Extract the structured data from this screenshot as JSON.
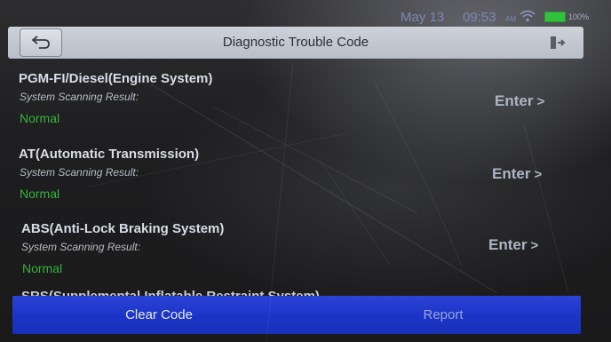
{
  "status_bar": {
    "date": "May 13",
    "time": "09:53",
    "ampm": "AM",
    "battery_label": "100%",
    "wifi_icon": "wifi-icon",
    "battery_color": "#33c13d"
  },
  "header": {
    "title": "Diagnostic Trouble Code",
    "back_icon": "back-arrow-icon",
    "exit_icon": "exit-icon"
  },
  "systems": [
    {
      "name": "PGM-FI/Diesel(Engine System)",
      "label": "System Scanning Result:",
      "status": "Normal",
      "enter_label": "Enter",
      "enter_glyph": ">"
    },
    {
      "name": "AT(Automatic Transmission)",
      "label": "System Scanning Result:",
      "status": "Normal",
      "enter_label": "Enter",
      "enter_glyph": ">"
    },
    {
      "name": "ABS(Anti-Lock Braking System)",
      "label": "System Scanning Result:",
      "status": "Normal",
      "enter_label": "Enter",
      "enter_glyph": ">"
    }
  ],
  "partial_row": "SRS(Supplemental Inflatable Restraint System)",
  "bottom_bar": {
    "clear_code_label": "Clear Code",
    "report_label": "Report",
    "bar_color": "#1d35c8"
  },
  "colors": {
    "status_normal": "#36b23a",
    "header_bg": "#c4c8d1"
  }
}
